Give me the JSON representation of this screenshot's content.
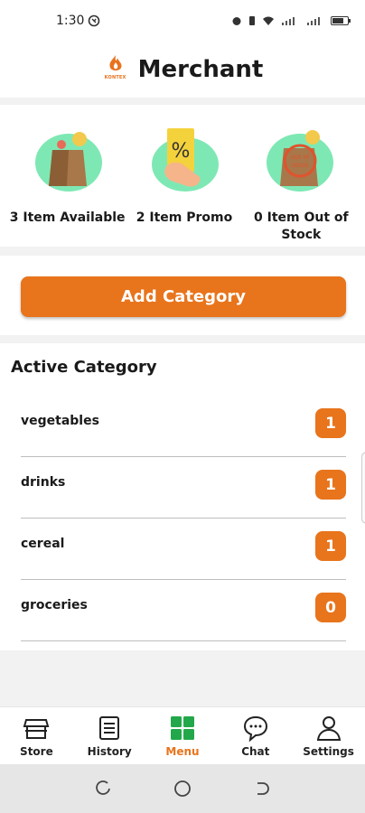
{
  "status_bar": {
    "time": "1:30"
  },
  "header": {
    "title": "Merchant",
    "logo_text": "KONTEX"
  },
  "stats": [
    {
      "label": "3 Item Available",
      "icon": "grocery-bag-icon"
    },
    {
      "label": "2 Item Promo",
      "icon": "promo-percent-icon"
    },
    {
      "label": "0 Item Out of Stock",
      "icon": "out-of-stock-bag-icon",
      "stamp": "out of stock"
    }
  ],
  "add_button": {
    "label": "Add Category"
  },
  "active_category": {
    "title": "Active Category",
    "items": [
      {
        "name": "vegetables",
        "count": "1"
      },
      {
        "name": "drinks",
        "count": "1"
      },
      {
        "name": "cereal",
        "count": "1"
      },
      {
        "name": "groceries",
        "count": "0"
      }
    ]
  },
  "bottom_nav": [
    {
      "label": "Store",
      "icon": "store-icon"
    },
    {
      "label": "History",
      "icon": "history-list-icon"
    },
    {
      "label": "Menu",
      "icon": "menu-grid-icon",
      "active": true
    },
    {
      "label": "Chat",
      "icon": "chat-bubble-icon"
    },
    {
      "label": "Settings",
      "icon": "user-settings-icon"
    }
  ],
  "colors": {
    "accent": "#e8741c",
    "illustration_green": "#7ee8b4",
    "menu_green": "#22a84a"
  }
}
